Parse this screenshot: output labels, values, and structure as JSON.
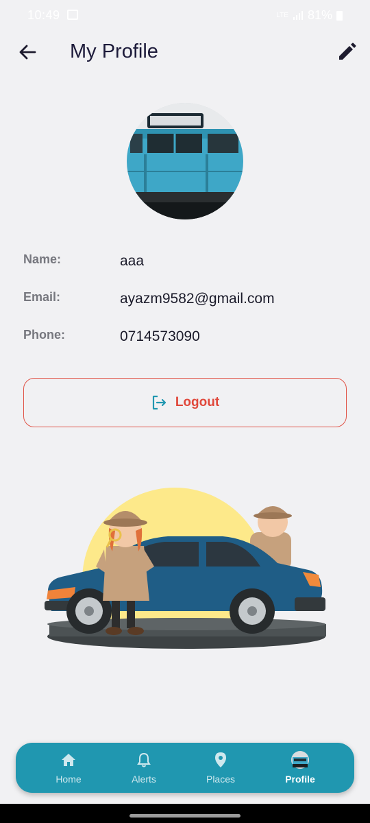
{
  "status_bar": {
    "time": "10:49",
    "network": "LTE",
    "battery": "81%"
  },
  "app_bar": {
    "title": "My Profile"
  },
  "profile": {
    "fields": [
      {
        "label": "Name:",
        "value": "aaa"
      },
      {
        "label": "Email:",
        "value": "ayazm9582@gmail.com"
      },
      {
        "label": "Phone:",
        "value": "0714573090"
      }
    ]
  },
  "logout": {
    "label": "Logout"
  },
  "bottom_nav": {
    "items": [
      {
        "label": "Home",
        "icon": "home-icon"
      },
      {
        "label": "Alerts",
        "icon": "bell-icon"
      },
      {
        "label": "Places",
        "icon": "location-pin-icon"
      },
      {
        "label": "Profile",
        "icon": "bus-avatar-icon"
      }
    ],
    "active": "Profile"
  },
  "colors": {
    "background": "#f1f1f3",
    "accent": "#2097b0",
    "logout": "#e0483b",
    "title": "#1d1b3a"
  }
}
